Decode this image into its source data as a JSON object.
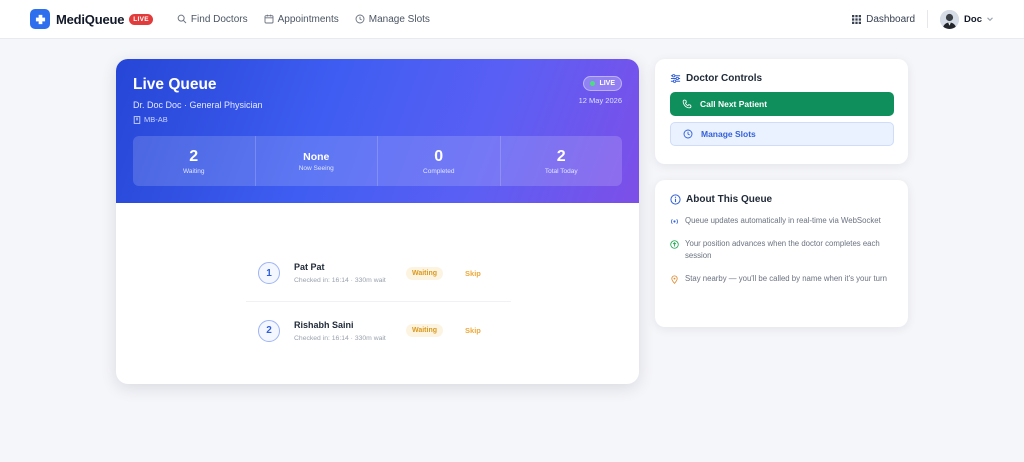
{
  "nav": {
    "brand": "MediQueue",
    "live_badge": "LIVE",
    "links": [
      "Find Doctors",
      "Appointments",
      "Manage Slots"
    ],
    "dashboard": "Dashboard",
    "user": "Doc"
  },
  "queue": {
    "title": "Live Queue",
    "doctor": "Dr. Doc Doc · General Physician",
    "code": "MB-AB",
    "live_label": "LIVE",
    "date": "12 May 2026",
    "stats": [
      {
        "value": "2",
        "label": "Waiting"
      },
      {
        "value": "None",
        "label": "Now Seeing"
      },
      {
        "value": "0",
        "label": "Completed"
      },
      {
        "value": "2",
        "label": "Total Today"
      }
    ],
    "patients": [
      {
        "position": "1",
        "name": "Pat Pat",
        "meta": "Checked in: 16:14 · 330m wait",
        "status": "Waiting",
        "action": "Skip"
      },
      {
        "position": "2",
        "name": "Rishabh Saini",
        "meta": "Checked in: 16:14 · 330m wait",
        "status": "Waiting",
        "action": "Skip"
      }
    ]
  },
  "controls": {
    "title": "Doctor Controls",
    "call_next": "Call Next Patient",
    "manage_slots": "Manage Slots"
  },
  "about": {
    "title": "About This Queue",
    "items": [
      "Queue updates automatically in real-time via WebSocket",
      "Your position advances when the doctor completes each session",
      "Stay nearby — you'll be called by name when it's your turn"
    ]
  },
  "colors": {
    "primary": "#2f6fed",
    "success": "#0f8f5c",
    "live": "#e23b3b",
    "waiting": "#d99a1e"
  },
  "icons": [
    "hospital-logo-icon",
    "search-icon",
    "calendar-icon",
    "clock-icon",
    "grid-icon",
    "chevron-down-icon",
    "building-icon",
    "sliders-icon",
    "phone-icon",
    "info-icon",
    "broadcast-icon",
    "arrow-up-circle-icon",
    "map-pin-icon"
  ]
}
